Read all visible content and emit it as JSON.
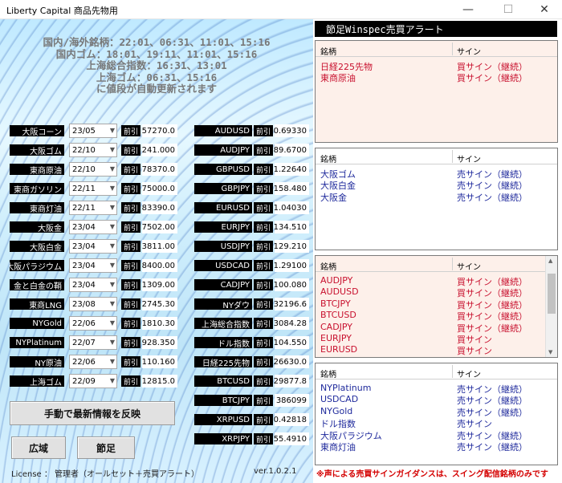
{
  "window": {
    "title": "Liberty Capital 商品先物用",
    "minimize_glyph": "—",
    "maximize_glyph": "☐",
    "close_glyph": "✕"
  },
  "schedule": [
    "国内/海外銘柄：22:01、06:31、11:01、15:16",
    "国内ゴム：18:01、19:11、11:01、15:16",
    "上海総合指数：16:31、13:01",
    "上海ゴム：06:31、15:16",
    "に値段が自動更新されます"
  ],
  "domestic": [
    {
      "name": "大阪コーン",
      "month": "23/05",
      "prefix": "前引",
      "value": "57270.0"
    },
    {
      "name": "大阪ゴム",
      "month": "22/10",
      "prefix": "前引",
      "value": "241.000"
    },
    {
      "name": "東商原油",
      "month": "22/10",
      "prefix": "前引",
      "value": "78370.0"
    },
    {
      "name": "東商ガソリン",
      "month": "22/11",
      "prefix": "前引",
      "value": "75000.0"
    },
    {
      "name": "東商灯油",
      "month": "22/11",
      "prefix": "前引",
      "value": "83390.0"
    },
    {
      "name": "大阪金",
      "month": "23/04",
      "prefix": "前引",
      "value": "7502.00"
    },
    {
      "name": "大阪白金",
      "month": "23/04",
      "prefix": "前引",
      "value": "3811.00"
    },
    {
      "name": "大阪パラジウム",
      "month": "23/04",
      "prefix": "前引",
      "value": "8400.00"
    },
    {
      "name": "金と白金の鞘",
      "month": "23/04",
      "prefix": "前引",
      "value": "1309.00"
    },
    {
      "name": "東商LNG",
      "month": "23/08",
      "prefix": "前引",
      "value": "2745.30"
    },
    {
      "name": "NYGold",
      "month": "22/06",
      "prefix": "前引",
      "value": "1810.30"
    },
    {
      "name": "NYPlatinum",
      "month": "22/07",
      "prefix": "前引",
      "value": "928.350"
    },
    {
      "name": "NY原油",
      "month": "22/06",
      "prefix": "前引",
      "value": "110.160"
    },
    {
      "name": "上海ゴム",
      "month": "22/09",
      "prefix": "前引",
      "value": "12815.0"
    }
  ],
  "fx": [
    {
      "name": "AUDUSD",
      "prefix": "前引",
      "value": "0.69330"
    },
    {
      "name": "AUDJPY",
      "prefix": "前引",
      "value": "89.6700"
    },
    {
      "name": "GBPUSD",
      "prefix": "前引",
      "value": "1.22640"
    },
    {
      "name": "GBPJPY",
      "prefix": "前引",
      "value": "158.480"
    },
    {
      "name": "EURUSD",
      "prefix": "前引",
      "value": "1.04030"
    },
    {
      "name": "EURJPY",
      "prefix": "前引",
      "value": "134.510"
    },
    {
      "name": "USDJPY",
      "prefix": "前引",
      "value": "129.210"
    },
    {
      "name": "USDCAD",
      "prefix": "前引",
      "value": "1.29100"
    },
    {
      "name": "CADJPY",
      "prefix": "前引",
      "value": "100.080"
    },
    {
      "name": "NYダウ",
      "prefix": "前引",
      "value": "32196.6"
    },
    {
      "name": "上海総合指数",
      "prefix": "前引",
      "value": "3084.28"
    },
    {
      "name": "ドル指数",
      "prefix": "前引",
      "value": "104.550"
    },
    {
      "name": "日経225先物",
      "prefix": "前引",
      "value": "26630.0"
    },
    {
      "name": "BTCUSD",
      "prefix": "前引",
      "value": "29877.8"
    },
    {
      "name": "BTCJPY",
      "prefix": "前引",
      "value": "386099"
    },
    {
      "name": "XRPUSD",
      "prefix": "前引",
      "value": "0.42818"
    },
    {
      "name": "XRPJPY",
      "prefix": "前引",
      "value": "55.4910"
    }
  ],
  "buttons": {
    "manual_update": "手動で最新情報を反映",
    "wide": "広域",
    "bar": "節足"
  },
  "license": "License ： 管理者（オールセット＋売買アラート）",
  "version": "ver.1.0.2.1",
  "alert_header": "節足Winspec売買アラート",
  "col_headers": {
    "name": "銘柄",
    "sign": "サイン"
  },
  "box1": [
    {
      "name": "日経225先物",
      "sign": "買サイン（継続）"
    },
    {
      "name": "東商原油",
      "sign": "買サイン（継続）"
    }
  ],
  "box2": [
    {
      "name": "大阪ゴム",
      "sign": "売サイン（継続）"
    },
    {
      "name": "大阪白金",
      "sign": "売サイン（継続）"
    },
    {
      "name": "大阪金",
      "sign": "売サイン（継続）"
    }
  ],
  "box3": [
    {
      "name": "AUDJPY",
      "sign": "買サイン（継続）"
    },
    {
      "name": "AUDUSD",
      "sign": "買サイン（継続）"
    },
    {
      "name": "BTCJPY",
      "sign": "買サイン（継続）"
    },
    {
      "name": "BTCUSD",
      "sign": "買サイン（継続）"
    },
    {
      "name": "CADJPY",
      "sign": "買サイン（継続）"
    },
    {
      "name": "EURJPY",
      "sign": "買サイン"
    },
    {
      "name": "EURUSD",
      "sign": "買サイン"
    }
  ],
  "box4": [
    {
      "name": "NYPlatinum",
      "sign": "売サイン（継続）"
    },
    {
      "name": "USDCAD",
      "sign": "売サイン（継続）"
    },
    {
      "name": "NYGold",
      "sign": "売サイン（継続）"
    },
    {
      "name": "ドル指数",
      "sign": "売サイン"
    },
    {
      "name": "大阪パラジウム",
      "sign": "売サイン（継続）"
    },
    {
      "name": "東商灯油",
      "sign": "売サイン（継続）"
    }
  ],
  "notice": "※声による売買サインガイダンスは、スイング配信銘柄のみです",
  "colors": {
    "buy": "#c8102e",
    "sell": "#1f2a9c",
    "notice": "#d40000"
  }
}
